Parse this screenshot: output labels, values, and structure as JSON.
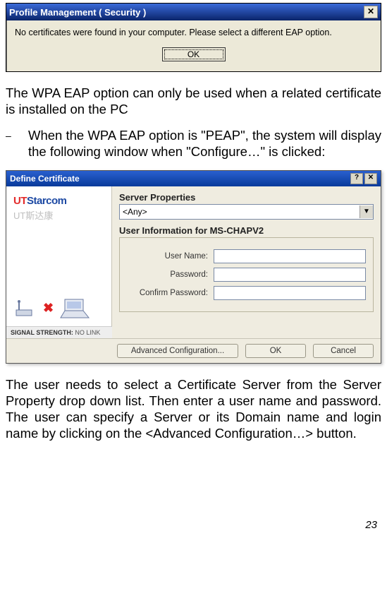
{
  "dialog1": {
    "title": "Profile Management ( Security )",
    "message": "No certificates were found in your computer.  Please select a different EAP option.",
    "ok_label": "OK"
  },
  "para1": "The WPA EAP option can only be used when a related certificate is installed on the PC",
  "bullet_dash": "–",
  "bullet1": "When the WPA EAP option is \"PEAP\", the system will display the following window when \"Configure…\" is clicked:",
  "dialog2": {
    "title": "Define Certificate",
    "brand_ut": "UT",
    "brand_star": "Starcom",
    "brand_cn": "UT斯达康",
    "signal_label": "SIGNAL STRENGTH:",
    "signal_value": "NO LINK",
    "server_props_label": "Server Properties",
    "combo_value": "<Any>",
    "userinfo_label": "User Information for MS-CHAPV2",
    "f_user": "User Name:",
    "f_pass": "Password:",
    "f_conf": "Confirm Password:",
    "btn_adv": "Advanced Configuration...",
    "btn_ok": "OK",
    "btn_cancel": "Cancel"
  },
  "para2": "The user needs to select a Certificate Server from the Server Property drop down list.  Then enter a user name and password. The user can specify a Server or its Domain name and login name by clicking on the <Advanced Configuration…> button.",
  "page_number": "23"
}
